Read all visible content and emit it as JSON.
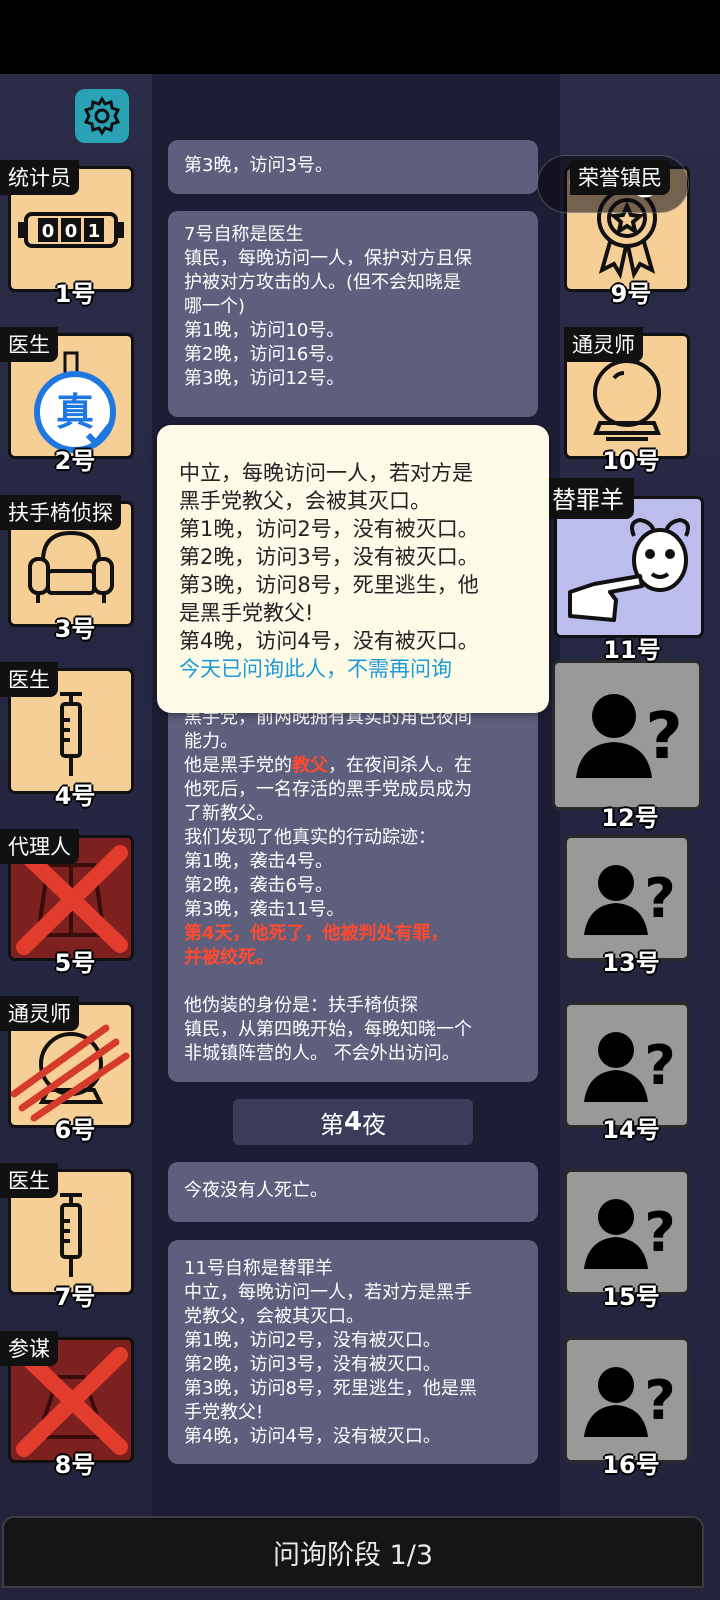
{
  "header": {
    "settings_icon": "gear-icon"
  },
  "capsule": {
    "menu_icon": "more-dots-icon",
    "dots": "•••",
    "close_icon": "target-close-icon"
  },
  "players_left": [
    {
      "role": "统计员",
      "number": "1号",
      "status": "alive",
      "icon": "counter-icon"
    },
    {
      "role": "医生",
      "number": "2号",
      "status": "alive",
      "icon": "verified-true-badge-icon"
    },
    {
      "role": "扶手椅侦探",
      "number": "3号",
      "status": "alive",
      "icon": "armchair-icon"
    },
    {
      "role": "医生",
      "number": "4号",
      "status": "alive",
      "icon": "syringe-icon"
    },
    {
      "role": "代理人",
      "number": "5号",
      "status": "dead",
      "icon": "trenchcoat-icon"
    },
    {
      "role": "通灵师",
      "number": "6号",
      "status": "attacked",
      "icon": "crystal-ball-icon"
    },
    {
      "role": "医生",
      "number": "7号",
      "status": "alive",
      "icon": "syringe-icon"
    },
    {
      "role": "参谋",
      "number": "8号",
      "status": "dead",
      "icon": "advisor-icon"
    }
  ],
  "players_right": [
    {
      "role": "荣誉镇民",
      "number": "9号",
      "status": "alive",
      "icon": "medal-icon"
    },
    {
      "role": "通灵师",
      "number": "10号",
      "status": "alive",
      "icon": "crystal-ball-icon"
    },
    {
      "role": "替罪羊",
      "number": "11号",
      "status": "selected",
      "icon": "scapegoat-icon"
    },
    {
      "role": "",
      "number": "12号",
      "status": "unknown",
      "icon": "unknown-person-icon"
    },
    {
      "role": "",
      "number": "13号",
      "status": "unknown",
      "icon": "unknown-person-icon"
    },
    {
      "role": "",
      "number": "14号",
      "status": "unknown",
      "icon": "unknown-person-icon"
    },
    {
      "role": "",
      "number": "15号",
      "status": "unknown",
      "icon": "unknown-person-icon"
    },
    {
      "role": "",
      "number": "16号",
      "status": "unknown",
      "icon": "unknown-person-icon"
    }
  ],
  "messages": {
    "cut_top": "第3晚，访问3号。",
    "doctor7": [
      "7号自称是医生",
      "镇民，每晚访问一人，保护对方且保",
      "护被对方攻击的人。(但不会知晓是",
      "哪一个)",
      "第1晚，访问10号。",
      "第2晚，访问16号。",
      "第3晚，访问12号。"
    ],
    "godfather": {
      "l1": "黑手党，前两晚拥有真实的角色夜间",
      "l2": "能力。",
      "l3a": "他是黑手党的",
      "l3b": "教父",
      "l3c": "，在夜间杀人。在",
      "l4": "他死后，一名存活的黑手党成员成为",
      "l5": "了新教父。",
      "l6": "我们发现了他真实的行动踪迹：",
      "l7": "第1晚，袭击4号。",
      "l8": "第2晚，袭击6号。",
      "l9": "第3晚，袭击11号。",
      "l10": "第4天，他死了，他被判处有罪，",
      "l11": "并被绞死。",
      "l12": "他伪装的身份是：扶手椅侦探",
      "l13": "镇民，从第四晚开始，每晚知晓一个",
      "l14": "非城镇阵营的人。 不会外出访问。"
    },
    "night": {
      "prefix": "第",
      "num": "4",
      "suffix": "夜"
    },
    "no_death": "今夜没有人死亡。",
    "scapegoat11": [
      "11号自称是替罪羊",
      "中立，每晚访问一人，若对方是黑手",
      "党教父，会被其灭口。",
      "第1晚，访问2号，没有被灭口。",
      "第2晚，访问3号，没有被灭口。",
      "第3晚，访问8号，死里逃生，他是黑",
      "手党教父!",
      "第4晚，访问4号，没有被灭口。"
    ]
  },
  "popup": {
    "lines": [
      "中立，每晚访问一人，若对方是",
      "黑手党教父，会被其灭口。",
      "第1晚，访问2号，没有被灭口。",
      "第2晚，访问3号，没有被灭口。",
      "第3晚，访问8号，死里逃生，他",
      "是黑手党教父!",
      "第4晚，访问4号，没有被灭口。"
    ],
    "note": "今天已问询此人，不需再问询"
  },
  "footer": {
    "phase": "问询阶段 1/3"
  },
  "colors": {
    "card": "#f5cf96",
    "dead": "#7d2020",
    "unknown": "#999999",
    "selected": "#bcbdec",
    "accent_red": "#ff4a2f",
    "accent_blue": "#1e9ad6",
    "settings": "#2aa2b6"
  }
}
